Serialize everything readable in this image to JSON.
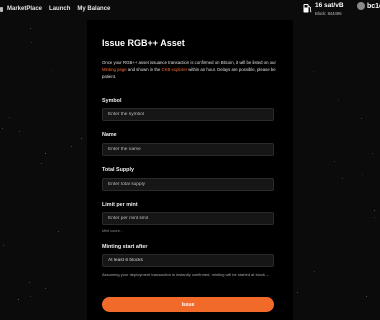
{
  "nav": {
    "items": [
      {
        "label": "MarketPlace"
      },
      {
        "label": "Launch"
      },
      {
        "label": "My Balance"
      }
    ]
  },
  "fee": {
    "rate": "16 sat/vB",
    "block": "Block: 844495"
  },
  "wallet": {
    "address": "bc1q"
  },
  "page": {
    "title": "Issue RGB++ Asset",
    "desc_part1": "Once your RGB++ asset issuance transaction is confirmed on Bitcoin, it will be listed on our ",
    "desc_link1": "Minting page",
    "desc_part2": " and shown in the ",
    "desc_link2": "CKB explorer",
    "desc_part3": " within an hour. Delays are possible, please be patient."
  },
  "form": {
    "symbol": {
      "label": "Symbol",
      "placeholder": "Enter the symbol"
    },
    "name": {
      "label": "Name",
      "placeholder": "Enter the name"
    },
    "supply": {
      "label": "Total Supply",
      "placeholder": "Enter total supply"
    },
    "limit": {
      "label": "Limit per mint",
      "placeholder": "Enter per mint limit",
      "hint": "Mint count: -"
    },
    "start": {
      "label": "Minting start after",
      "value": "At least 6 blocks",
      "note": "Assuming your deployment transaction is instantly confirmed, minting will be started at block --"
    },
    "submit_label": "Issue"
  },
  "colors": {
    "accent": "#f26a2a",
    "background": "#0b0b0b",
    "panel": "#000000"
  }
}
